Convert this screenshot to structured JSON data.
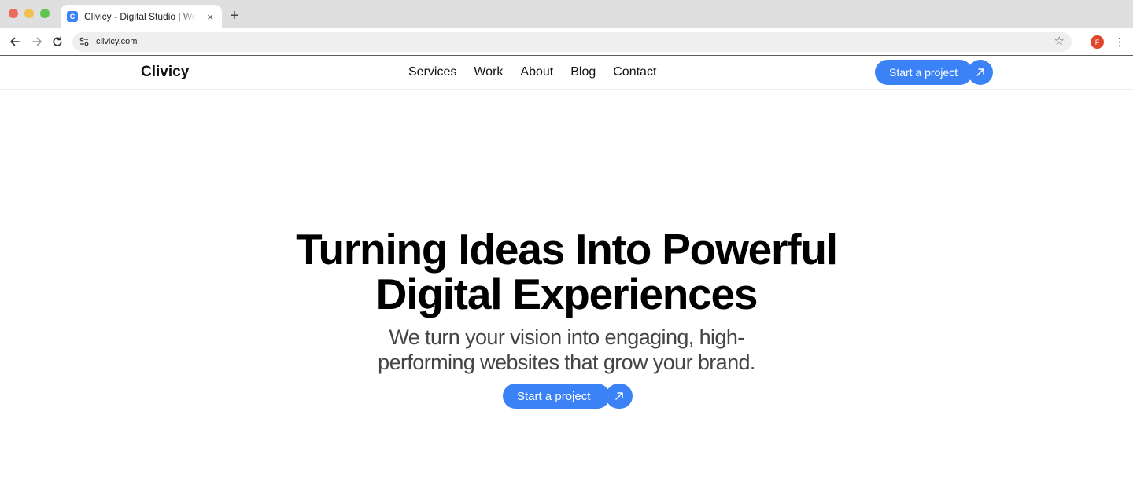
{
  "browser": {
    "tab": {
      "favicon_letter": "C",
      "title": "Clivicy - Digital Studio | Web Design"
    },
    "new_tab_label": "+",
    "close_label": "×",
    "url": "clivicy.com",
    "profile_initial": "F"
  },
  "site": {
    "logo": "Clivicy",
    "nav": [
      {
        "label": "Services"
      },
      {
        "label": "Work"
      },
      {
        "label": "About"
      },
      {
        "label": "Blog"
      },
      {
        "label": "Contact"
      }
    ],
    "header_cta": "Start a project",
    "hero": {
      "title_line1": "Turning Ideas Into Powerful",
      "title_line2": "Digital Experiences",
      "subtitle": "We turn your vision into engaging, high-performing websites that grow your brand.",
      "cta": "Start a project"
    }
  },
  "colors": {
    "accent": "#3b82f6",
    "profile": "#e0452b",
    "chrome_bg": "#dfdfdf"
  },
  "icons": {
    "cta_arrow": "arrow-up-right-icon",
    "back": "arrow-left-icon",
    "forward": "arrow-right-icon",
    "reload": "reload-icon",
    "bookmark": "star-icon",
    "menu": "kebab-menu-icon",
    "site_settings": "tune-icon"
  }
}
